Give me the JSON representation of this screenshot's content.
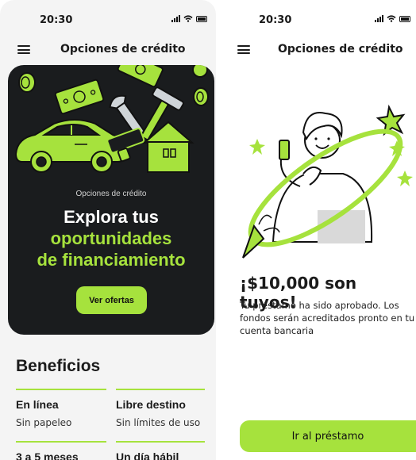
{
  "colors": {
    "accent": "#a6e23d",
    "hero_bg": "#1a1c1e",
    "text": "#1b1b1b"
  },
  "screen1": {
    "status_time": "20:30",
    "nav_title": "Opciones de crédito",
    "hero": {
      "kicker": "Opciones de crédito",
      "title_line1": "Explora tus",
      "title_line2": "oportunidades",
      "title_line3": "de financiamiento",
      "button_label": "Ver ofertas"
    },
    "benefits": {
      "heading": "Beneficios",
      "items": [
        {
          "title": "En línea",
          "subtitle": "Sin papeleo"
        },
        {
          "title": "Libre destino",
          "subtitle": "Sin límites de uso"
        },
        {
          "title": "3 a 5 meses",
          "subtitle": ""
        },
        {
          "title": "Un día hábil",
          "subtitle": ""
        }
      ]
    }
  },
  "screen2": {
    "status_time": "20:30",
    "nav_title": "Opciones de crédito",
    "headline": "¡$10,000 son tuyos!",
    "message": "Tu préstamo ha sido aprobado. Los fondos serán acreditados pronto en tu cuenta bancaria",
    "button_label": "Ir al préstamo"
  }
}
